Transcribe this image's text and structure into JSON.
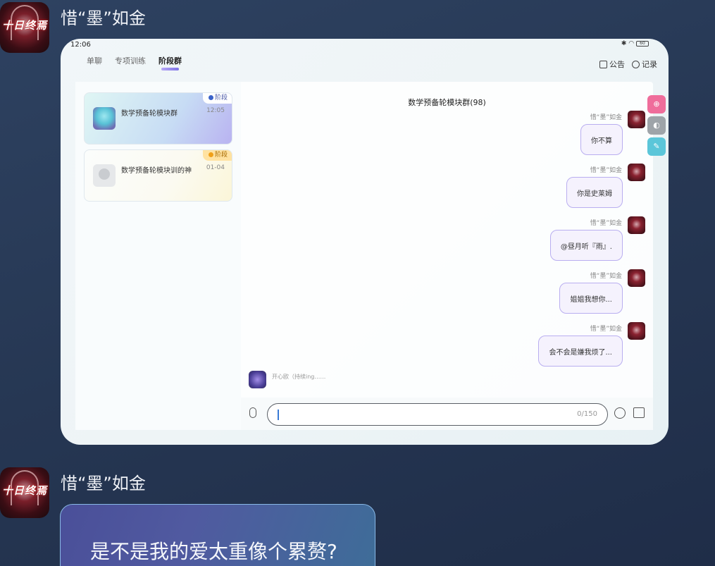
{
  "messages": [
    {
      "sender": "惜“墨”如金",
      "avatar_text": "十日终焉"
    },
    {
      "sender": "惜“墨”如金",
      "avatar_text": "十日终焉",
      "text": "是不是我的爱太重像个累赘?"
    }
  ],
  "screenshot": {
    "status_time": "12:06",
    "status_icons": "✱ ◠",
    "battery": "60",
    "tabs": [
      "单聊",
      "专项训练",
      "阶段群"
    ],
    "active_tab": 2,
    "actions": {
      "announcement": "公告",
      "record": "记录"
    },
    "groups": [
      {
        "name": "数学预备轮模块群",
        "time": "12:05",
        "tag": "阶段"
      },
      {
        "name": "数学预备轮模块训的神",
        "time": "01-04",
        "tag": "阶段"
      }
    ],
    "chat_title": "数学预备轮模块群(98)",
    "chat_messages": [
      {
        "name": "惜“墨”如金",
        "text": "你不算"
      },
      {
        "name": "惜“墨”如金",
        "text": "你是史莱姆"
      },
      {
        "name": "惜“墨”如金",
        "text": "@昼月听『雨』."
      },
      {
        "name": "惜“墨”如金",
        "text": "姐姐我想你..."
      },
      {
        "name": "惜“墨”如金",
        "text": "会不会是嫌我烦了..."
      }
    ],
    "typing": "开心欧（持续ing……",
    "input_counter": "0/150",
    "side_tools": [
      "zoom-icon",
      "contrast-icon",
      "pen-icon"
    ]
  },
  "colors": {
    "accent": "#7d72e6",
    "bubble_border": "#b9aef0",
    "background": "#263753"
  }
}
